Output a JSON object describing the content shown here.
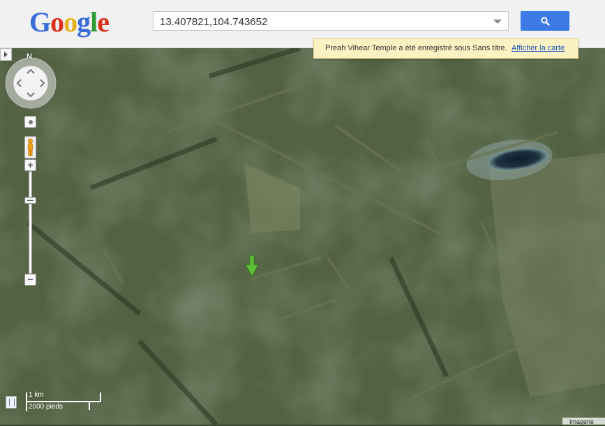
{
  "header": {
    "logo_letters": [
      {
        "char": "G",
        "color": "#3b6ad9"
      },
      {
        "char": "o",
        "color": "#d8321d"
      },
      {
        "char": "o",
        "color": "#e6b11b"
      },
      {
        "char": "g",
        "color": "#3b6ad9"
      },
      {
        "char": "l",
        "color": "#2f9b34"
      },
      {
        "char": "e",
        "color": "#d8321d"
      }
    ],
    "search_value": "13.407821,104.743652",
    "search_button_icon": "search-icon"
  },
  "notice": {
    "message": "Preah Vihear Temple a été enregistré sous Sans titre.",
    "link": "Afficher la carte"
  },
  "map_controls": {
    "north_label": "N",
    "zoom_in": "+",
    "zoom_out": "−",
    "zoom_level_fraction": 0.27
  },
  "scale": {
    "metric": "1 km",
    "imperial": "2000 pieds"
  },
  "attribution": "Imagerie",
  "colors": {
    "accent": "#3d7ae6",
    "marker": "#5fbf3a",
    "notice_bg": "#fbf2c4"
  }
}
